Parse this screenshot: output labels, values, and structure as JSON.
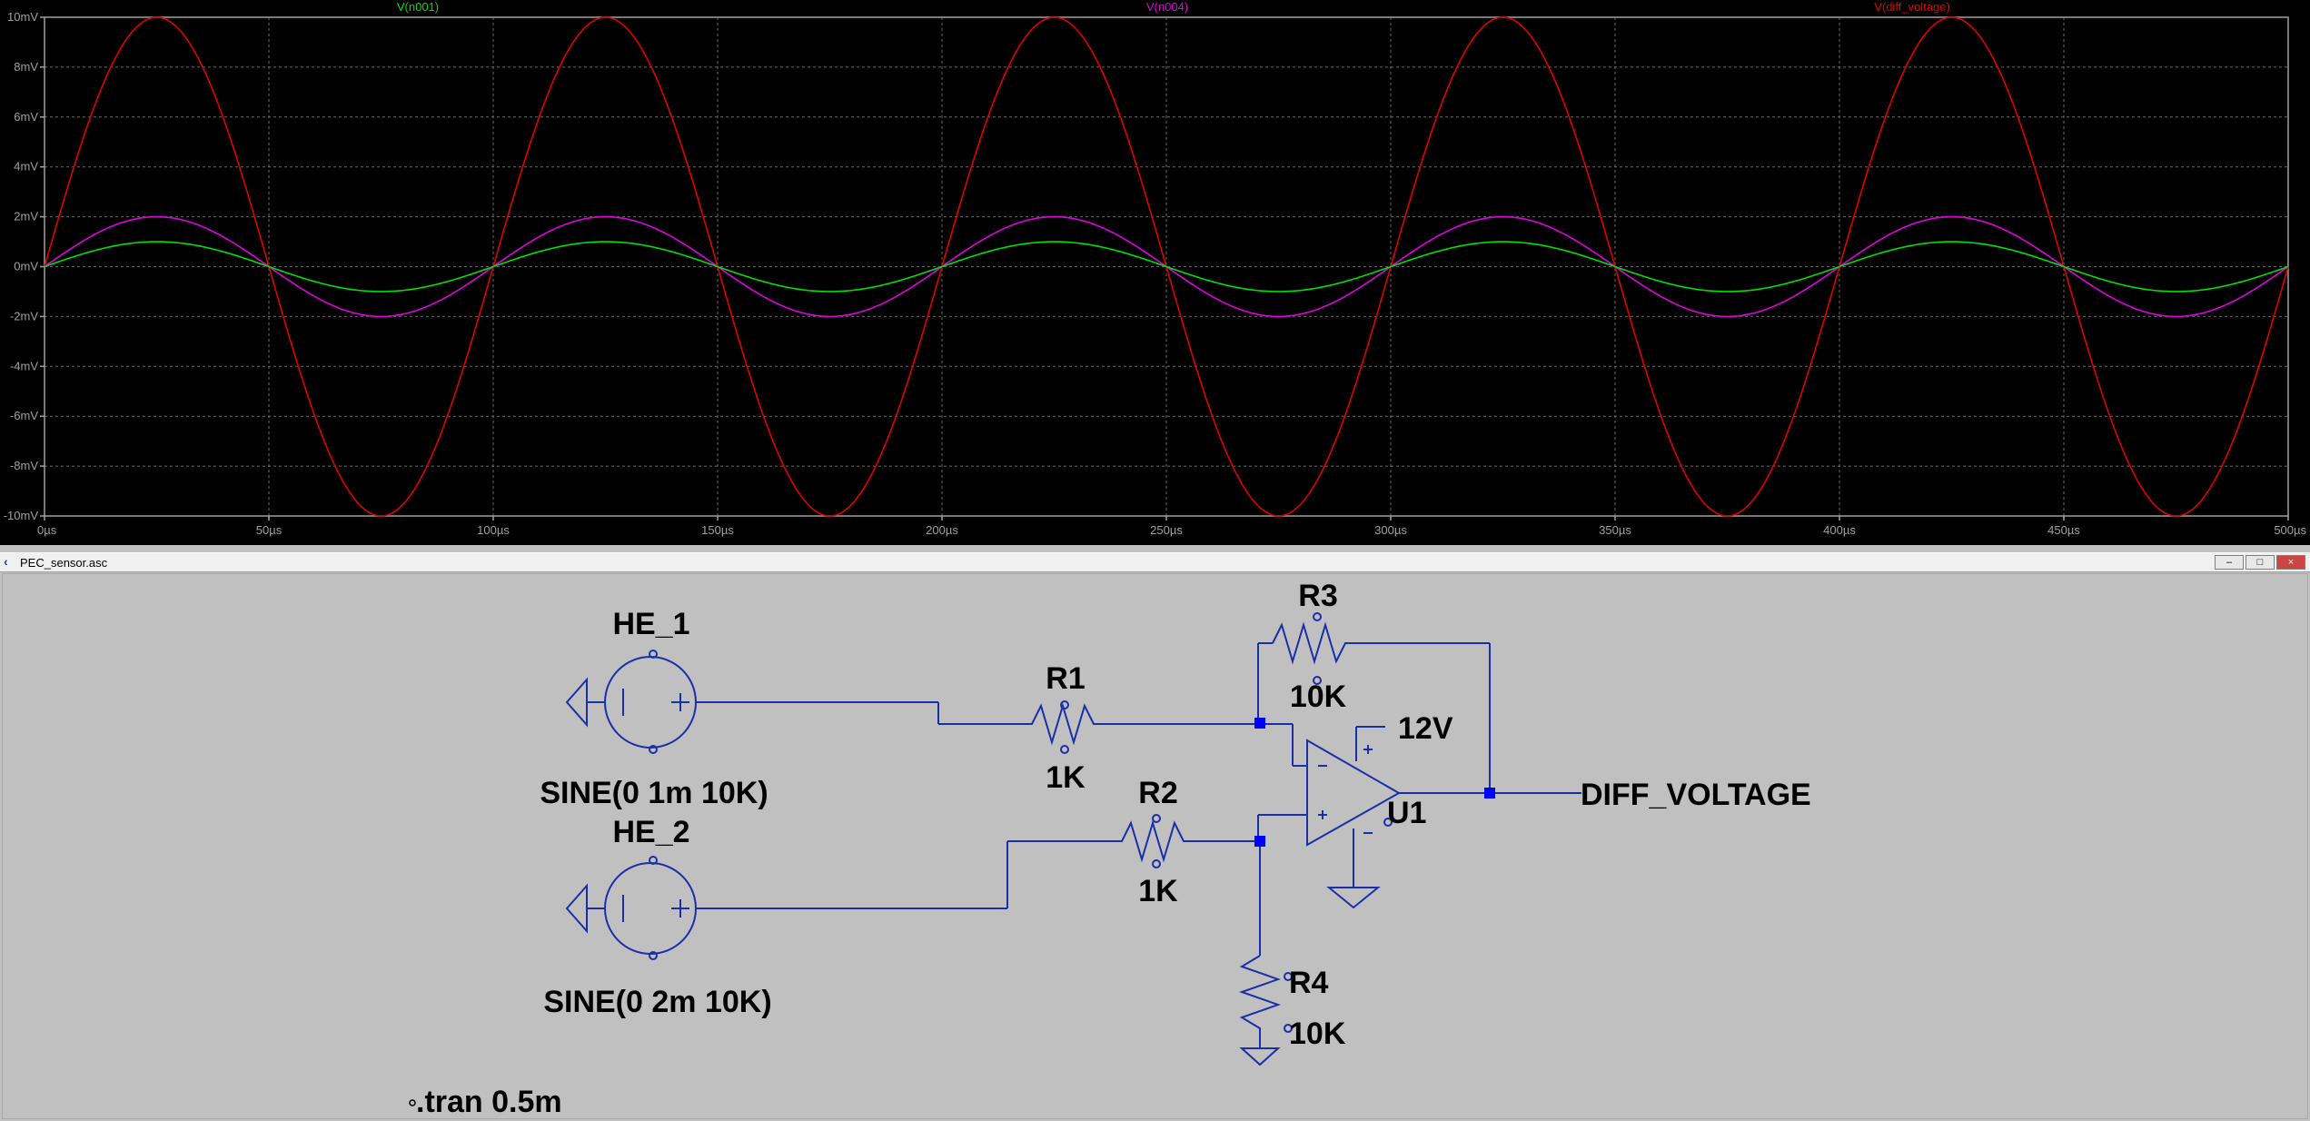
{
  "plot": {
    "traces": [
      {
        "label": "V(n001)",
        "color": "#00e000",
        "amplitude_mV": 1,
        "phase": 1
      },
      {
        "label": "V(n004)",
        "color": "#e000e0",
        "amplitude_mV": 2,
        "phase": 1
      },
      {
        "label": "V(diff_voltage)",
        "color": "#e00000",
        "amplitude_mV": 10,
        "phase": 1
      }
    ],
    "frequency_hz": 10000,
    "y_ticks": [
      "10mV",
      "8mV",
      "6mV",
      "4mV",
      "2mV",
      "0mV",
      "-2mV",
      "-4mV",
      "-6mV",
      "-8mV",
      "-10mV"
    ],
    "x_ticks": [
      "0µs",
      "50µs",
      "100µs",
      "150µs",
      "200µs",
      "250µs",
      "300µs",
      "350µs",
      "400µs",
      "450µs",
      "500µs"
    ],
    "x_range_us": [
      0,
      500
    ],
    "y_range_mV": [
      -10,
      10
    ],
    "grid": true
  },
  "chart_data": {
    "type": "line",
    "x_unit": "µs",
    "x": [
      0,
      25,
      50,
      75,
      100,
      125,
      150,
      175,
      200,
      225,
      250,
      275,
      300,
      325,
      350,
      375,
      400,
      425,
      450,
      475,
      500
    ],
    "series": [
      {
        "name": "V(n001)",
        "values": [
          0,
          1,
          0,
          -1,
          0,
          1,
          0,
          -1,
          0,
          1,
          0,
          -1,
          0,
          1,
          0,
          -1,
          0,
          1,
          0,
          -1,
          0
        ]
      },
      {
        "name": "V(n004)",
        "values": [
          0,
          2,
          0,
          -2,
          0,
          2,
          0,
          -2,
          0,
          2,
          0,
          -2,
          0,
          2,
          0,
          -2,
          0,
          2,
          0,
          -2,
          0
        ]
      },
      {
        "name": "V(diff_voltage)",
        "values": [
          0,
          10,
          0,
          -10,
          0,
          10,
          0,
          -10,
          0,
          10,
          0,
          -10,
          0,
          10,
          0,
          -10,
          0,
          10,
          0,
          -10,
          0
        ]
      }
    ],
    "xlim": [
      0,
      500
    ],
    "ylim": [
      -10,
      10
    ],
    "y_unit": "mV",
    "grid": true
  },
  "window": {
    "title": "PEC_sensor.asc",
    "minimize": "–",
    "maximize": "□",
    "close": "×"
  },
  "schematic": {
    "he1_name": "HE_1",
    "he1_value": "SINE(0 1m 10K)",
    "he2_name": "HE_2",
    "he2_value": "SINE(0 2m 10K)",
    "r1_name": "R1",
    "r1_value": "1K",
    "r2_name": "R2",
    "r2_value": "1K",
    "r3_name": "R3",
    "r3_value": "10K",
    "r4_name": "R4",
    "r4_value": "10K",
    "u1_name": "U1",
    "supply_label": "12V",
    "net_label": "DIFF_VOLTAGE",
    "directive": ".tran 0.5m",
    "wire_color": "#1a2ea8",
    "node_color": "#0000ff"
  }
}
